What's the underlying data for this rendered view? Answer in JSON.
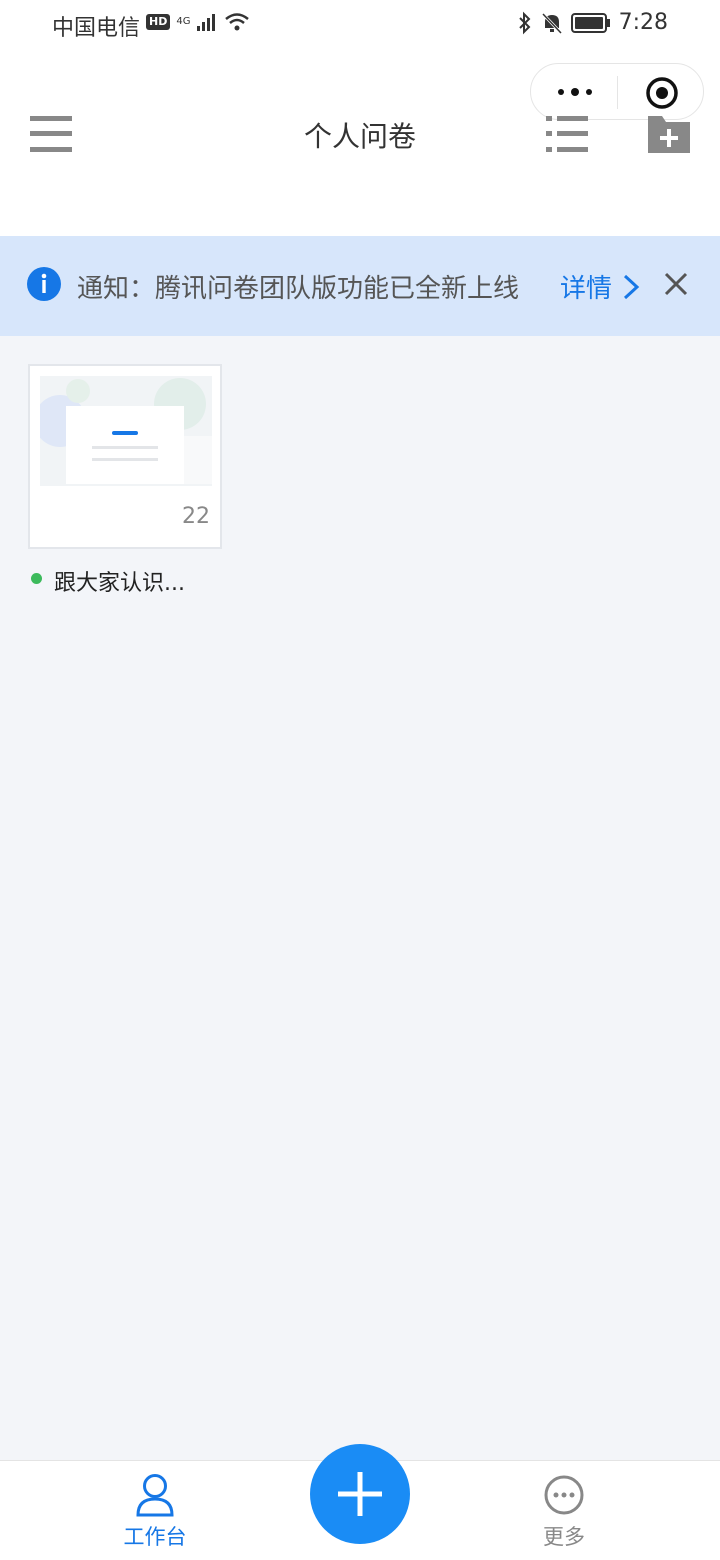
{
  "status_bar": {
    "carrier": "中国电信",
    "hd_badge": "HD",
    "network": "4G",
    "time": "7:28"
  },
  "header": {
    "title": "个人问卷"
  },
  "notice": {
    "text": "通知：腾讯问卷团队版功能已全新上线",
    "link_label": "详情"
  },
  "surveys": [
    {
      "title": "跟大家认识...",
      "count": "22",
      "status_color": "#3cba5c"
    }
  ],
  "tabbar": {
    "workbench_label": "工作台",
    "more_label": "更多"
  },
  "colors": {
    "accent": "#1677e6",
    "fab": "#1a8cf5",
    "notice_bg": "#d7e6fb"
  },
  "icons": {
    "menu": "menu-icon",
    "list": "list-icon",
    "add_folder": "add-folder-icon",
    "info": "info-icon",
    "close": "close-icon",
    "user": "user-icon",
    "more": "more-circle-icon",
    "add": "plus-icon"
  }
}
